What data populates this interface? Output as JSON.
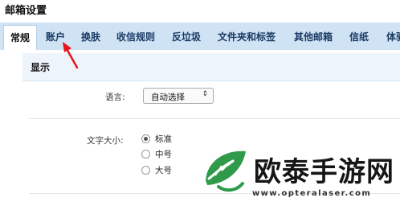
{
  "page": {
    "title": "邮箱设置"
  },
  "tabs": [
    {
      "label": "常规"
    },
    {
      "label": "账户"
    },
    {
      "label": "换肤"
    },
    {
      "label": "收信规则"
    },
    {
      "label": "反垃圾"
    },
    {
      "label": "文件夹和标签"
    },
    {
      "label": "其他邮箱"
    },
    {
      "label": "信纸"
    },
    {
      "label": "体验"
    }
  ],
  "section": {
    "title": "显示"
  },
  "language": {
    "label": "语言:",
    "selected": "自动选择"
  },
  "font_size": {
    "label": "文字大小:",
    "options": [
      {
        "label": "标准",
        "checked": true
      },
      {
        "label": "中号",
        "checked": false
      },
      {
        "label": "大号",
        "checked": false
      }
    ]
  },
  "watermark": {
    "text": "欧泰手游网",
    "url": "www.opteralaser.com"
  },
  "colors": {
    "tab_bar": "#cfe3f5",
    "arrow": "#e8141c",
    "logo_green": "#2f9a4a"
  }
}
